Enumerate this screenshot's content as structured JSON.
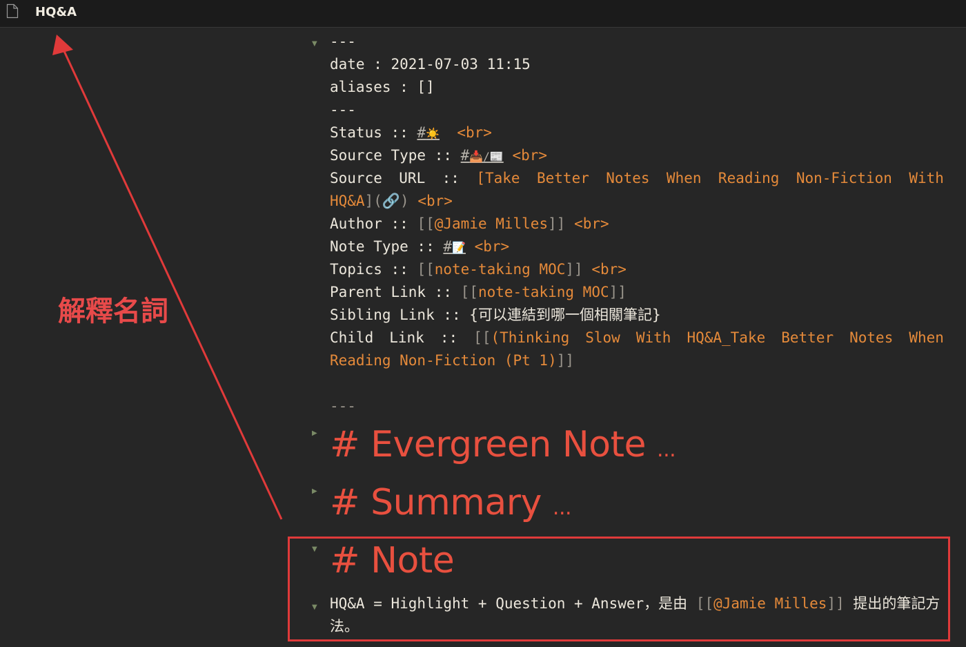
{
  "titlebar": {
    "title": "HQ&A"
  },
  "annotation": {
    "label": "解釋名詞"
  },
  "frontmatter": {
    "open": "---",
    "date": "date : 2021-07-03 11:15",
    "aliases": "aliases : []",
    "close": "---"
  },
  "props": {
    "status": {
      "key": "Status :: ",
      "tag_hash": "#",
      "tag_emoji": "☀️",
      "br": "<br>"
    },
    "source_type": {
      "key": "Source Type :: ",
      "tag_hash": "#",
      "tag_emoji": "📥/📰",
      "br": "<br>"
    },
    "source_url": {
      "key_words": [
        "Source",
        "URL",
        "::"
      ],
      "line1_words": [
        "[Take",
        "Better",
        "Notes",
        "When",
        "Reading",
        "Non-Fiction",
        "With"
      ],
      "line2_link": "HQ&A",
      "line2_bracket": "](🔗)",
      "br": "<br>"
    },
    "author": {
      "key": "Author :: ",
      "open": "[[",
      "link": "@Jamie Milles",
      "close": "]]",
      "br": "<br>"
    },
    "note_type": {
      "key": "Note Type :: ",
      "tag_hash": "#",
      "tag_emoji": "📝",
      "br": "<br>"
    },
    "topics": {
      "key": "Topics :: ",
      "open": "[[",
      "link": "note-taking MOC",
      "close": "]]",
      "br": "<br>"
    },
    "parent_link": {
      "key": "Parent Link :: ",
      "open": "[[",
      "link": "note-taking MOC",
      "close": "]]"
    },
    "sibling_link": {
      "key": "Sibling Link :: ",
      "value": "{可以連結到哪一個相關筆記}"
    },
    "child_link": {
      "key_words": [
        "Child",
        "Link",
        "::"
      ],
      "open": "[[",
      "line1_words": [
        "(Thinking",
        "Slow",
        "With",
        "HQ&A_Take",
        "Better",
        "Notes",
        "When"
      ],
      "line2_link": "Reading Non-Fiction (Pt 1)",
      "close": "]]"
    }
  },
  "divider": "---",
  "headings": [
    {
      "text": "# Evergreen Note",
      "ellipsis": "..."
    },
    {
      "text": "# Summary",
      "ellipsis": "..."
    },
    {
      "text": "# Note",
      "ellipsis": ""
    }
  ],
  "note_body": {
    "before": "HQ&A = Highlight + Question + Answer，是由 ",
    "open": "[[",
    "link": "@Jamie Milles",
    "close": "]]",
    "after": " 提出的筆記方法。"
  },
  "colors": {
    "accent": "#e8503f",
    "link": "#e58a3a",
    "annotation": "#e03a3a"
  }
}
